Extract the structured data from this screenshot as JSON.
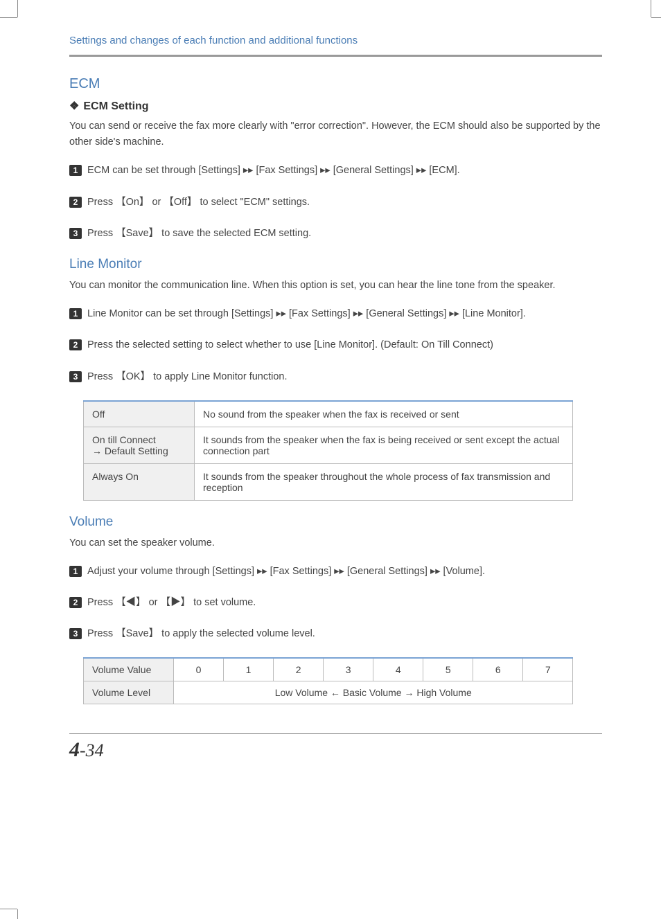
{
  "running_head": "Settings and changes of each function and additional functions",
  "ecm": {
    "title": "ECM",
    "subtitle": "ECM Setting",
    "intro": "You can send or receive the fax more clearly with \"error correction\". However, the ECM should also be supported by the other side's machine.",
    "steps": [
      " ECM can be set through [Settings] ▸▸ [Fax Settings] ▸▸ [General Settings] ▸▸ [ECM].",
      "Press 【On】 or 【Off】 to select \"ECM\" settings.",
      "Press 【Save】 to save the selected ECM setting."
    ]
  },
  "line_monitor": {
    "title": "Line Monitor",
    "intro": "You can monitor the communication line. When this option is set, you can hear the line tone from the speaker.",
    "steps": [
      "Line Monitor can be set through [Settings] ▸▸ [Fax Settings] ▸▸ [General Settings] ▸▸ [Line Monitor].",
      "Press the selected setting to select whether to use [Line Monitor]. (Default: On Till Connect)",
      "Press 【OK】 to apply Line Monitor function."
    ],
    "table": [
      {
        "label": "Off",
        "desc": "No sound from the speaker when the fax is received or sent"
      },
      {
        "label_line1": "On till Connect",
        "label_line2": "→ Default Setting",
        "desc": "It sounds from the speaker when the fax is being received or sent except the actual connection part"
      },
      {
        "label": "Always On",
        "desc": "It sounds from the speaker throughout the whole process of fax transmission and reception"
      }
    ]
  },
  "volume": {
    "title": "Volume",
    "intro": "You can set the speaker volume.",
    "steps": [
      "Adjust your volume through [Settings] ▸▸ [Fax Settings] ▸▸ [General Settings] ▸▸ [Volume].",
      "Press 【◀】 or 【▶】 to set volume.",
      "Press 【Save】 to apply the selected volume level."
    ],
    "value_row_label": "Volume Value",
    "values": [
      "0",
      "1",
      "2",
      "3",
      "4",
      "5",
      "6",
      "7"
    ],
    "level_row_label": "Volume Level",
    "level_text": "Low Volume   ←   Basic Volume   →   High Volume"
  },
  "page_number_big": "4",
  "page_number_small": "-34"
}
